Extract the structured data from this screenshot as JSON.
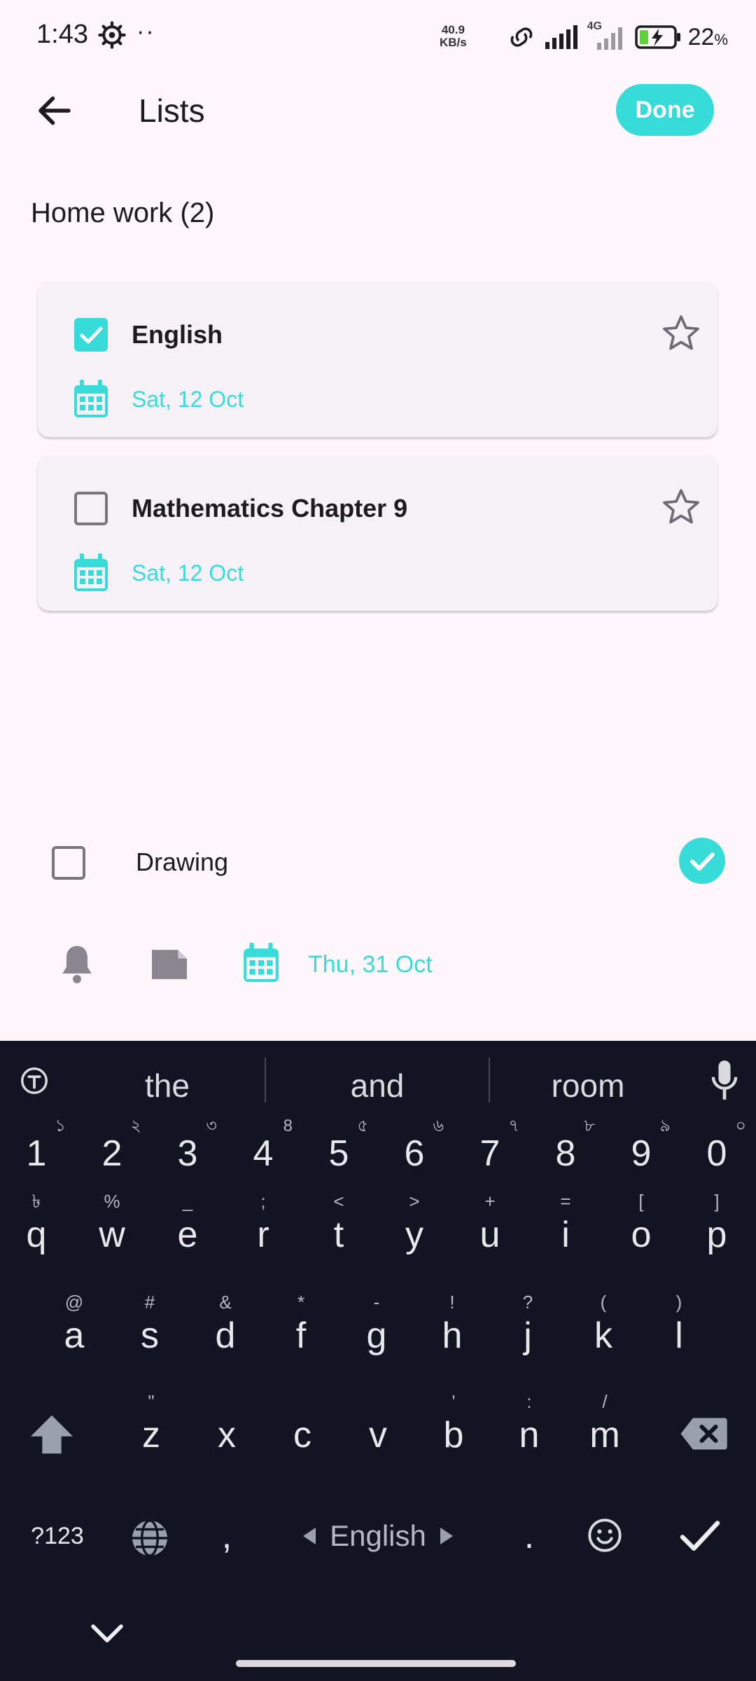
{
  "status_bar": {
    "time": "1:43",
    "net_speed_value": "40.9",
    "net_speed_unit": "KB/s",
    "network_type": "4G",
    "battery": "22",
    "battery_unit": "%"
  },
  "app_bar": {
    "title": "Lists",
    "done_label": "Done"
  },
  "list": {
    "section_title": "Home work (2)",
    "tasks": [
      {
        "title": "English",
        "checked": true,
        "starred": false,
        "date": "Sat, 12 Oct"
      },
      {
        "title": "Mathematics Chapter 9",
        "checked": false,
        "starred": false,
        "date": "Sat, 12 Oct"
      }
    ]
  },
  "new_task": {
    "text": "Drawing",
    "date": "Thu, 31 Oct"
  },
  "keyboard": {
    "suggestions": [
      "the",
      "and",
      "room"
    ],
    "number_row": [
      {
        "k": "1",
        "h": "১"
      },
      {
        "k": "2",
        "h": "২"
      },
      {
        "k": "3",
        "h": "৩"
      },
      {
        "k": "4",
        "h": "8"
      },
      {
        "k": "5",
        "h": "৫"
      },
      {
        "k": "6",
        "h": "৬"
      },
      {
        "k": "7",
        "h": "৭"
      },
      {
        "k": "8",
        "h": "৮"
      },
      {
        "k": "9",
        "h": "৯"
      },
      {
        "k": "0",
        "h": "০"
      }
    ],
    "row1": [
      {
        "k": "q",
        "h": "৳"
      },
      {
        "k": "w",
        "h": "%"
      },
      {
        "k": "e",
        "h": "_"
      },
      {
        "k": "r",
        "h": ";"
      },
      {
        "k": "t",
        "h": "<"
      },
      {
        "k": "y",
        "h": ">"
      },
      {
        "k": "u",
        "h": "+"
      },
      {
        "k": "i",
        "h": "="
      },
      {
        "k": "o",
        "h": "["
      },
      {
        "k": "p",
        "h": "]"
      }
    ],
    "row2": [
      {
        "k": "a",
        "h": "@"
      },
      {
        "k": "s",
        "h": "#"
      },
      {
        "k": "d",
        "h": "&"
      },
      {
        "k": "f",
        "h": "*"
      },
      {
        "k": "g",
        "h": "-"
      },
      {
        "k": "h",
        "h": "!"
      },
      {
        "k": "j",
        "h": "?"
      },
      {
        "k": "k",
        "h": "("
      },
      {
        "k": "l",
        "h": ")"
      }
    ],
    "row3": [
      {
        "k": "z",
        "h": "\""
      },
      {
        "k": "x",
        "h": ""
      },
      {
        "k": "c",
        "h": ""
      },
      {
        "k": "v",
        "h": ""
      },
      {
        "k": "b",
        "h": "'"
      },
      {
        "k": "n",
        "h": ":"
      },
      {
        "k": "m",
        "h": "/"
      }
    ],
    "symbols_label": "?123",
    "comma": ",",
    "space_label": "English",
    "period": "."
  },
  "colors": {
    "accent": "#37dbd8",
    "background": "#fdf7fc",
    "card": "#f6f1f7",
    "keyboard": "#121521"
  }
}
